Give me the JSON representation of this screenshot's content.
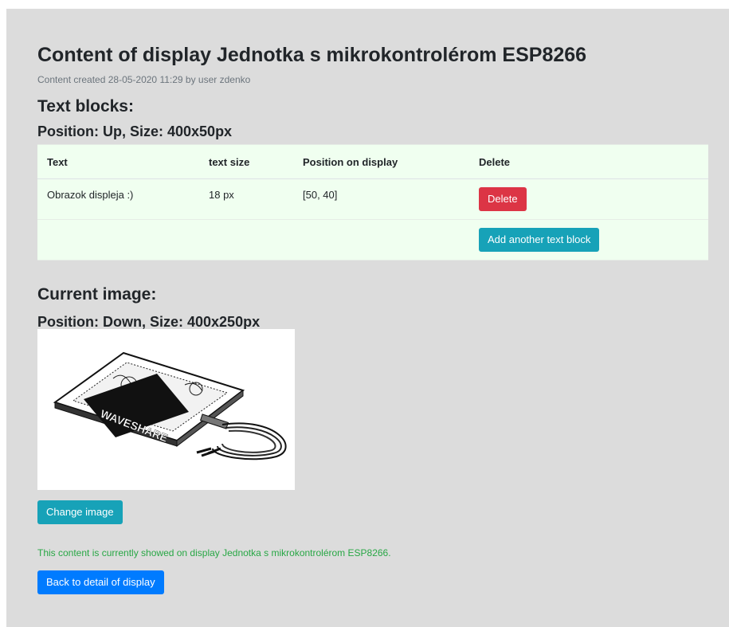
{
  "header": {
    "title": "Content of display Jednotka s mikrokontrolérom ESP8266",
    "subtitle": "Content created 28-05-2020 11:29 by user zdenko"
  },
  "text_blocks": {
    "heading": "Text blocks:",
    "position_heading": "Position: Up, Size: 400x50px",
    "columns": [
      "Text",
      "text size",
      "Position on display",
      "Delete"
    ],
    "rows": [
      {
        "text": "Obrazok displeja :)",
        "size": "18 px",
        "position": "[50, 40]",
        "delete_label": "Delete"
      }
    ],
    "add_label": "Add another text block"
  },
  "image": {
    "heading": "Current image:",
    "position_heading": "Position: Down, Size: 400x250px",
    "logo_text": "WAVESHARE",
    "change_label": "Change image"
  },
  "status": "This content is currently showed on display Jednotka s mikrokontrolérom ESP8266.",
  "back_label": "Back to detail of display",
  "colors": {
    "panel": "#dcdcdc",
    "table_bg": "#f0fff0",
    "danger": "#dc3545",
    "info": "#17a2b8",
    "primary": "#007bff",
    "success_text": "#28a745"
  }
}
